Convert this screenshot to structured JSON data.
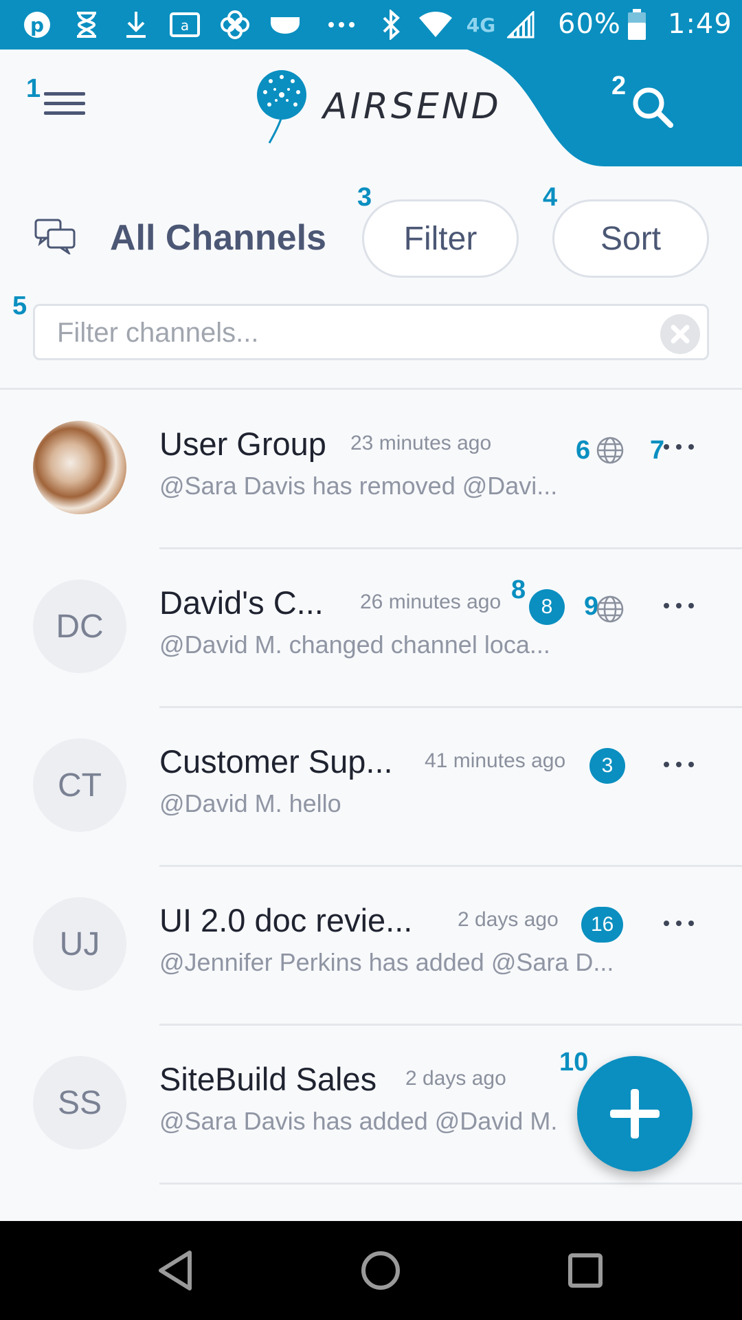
{
  "status": {
    "battery": "60%",
    "time": "1:49",
    "network": "4G"
  },
  "app": {
    "name": "AIRSEND"
  },
  "markers": [
    "1",
    "2",
    "3",
    "4",
    "5",
    "6",
    "7",
    "8",
    "9",
    "10"
  ],
  "toolbar": {
    "title": "All Channels",
    "filter_label": "Filter",
    "sort_label": "Sort"
  },
  "search": {
    "placeholder": "Filter channels..."
  },
  "channels": [
    {
      "avatar": "",
      "title": "User Group",
      "time": "23 minutes ago",
      "preview": "@Sara Davis  has removed @Davi...",
      "badge": "",
      "public": true
    },
    {
      "avatar": "DC",
      "title": "David's C...",
      "time": "26 minutes ago",
      "preview": "@David M. changed channel loca...",
      "badge": "8",
      "public": true
    },
    {
      "avatar": "CT",
      "title": "Customer Sup...",
      "time": "41 minutes ago",
      "preview": "@David M. hello",
      "badge": "3",
      "public": false
    },
    {
      "avatar": "UJ",
      "title": "UI 2.0 doc revie...",
      "time": "2 days ago",
      "preview": "@Jennifer Perkins has added @Sara D...",
      "badge": "16",
      "public": false
    },
    {
      "avatar": "SS",
      "title": "SiteBuild Sales",
      "time": "2 days ago",
      "preview": "@Sara Davis has added @David M.",
      "badge": "",
      "public": false
    }
  ],
  "colors": {
    "accent": "#0a8fc0",
    "text_dark": "#1f2330",
    "text_muted": "#8f95a3"
  }
}
